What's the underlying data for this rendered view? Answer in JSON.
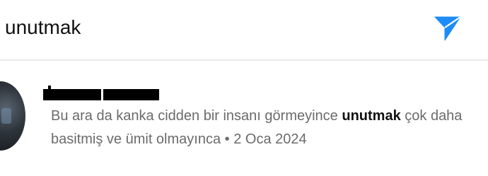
{
  "search": {
    "query": "unutmak",
    "send_icon": "paper-plane-icon",
    "send_color": "#1d8cf8"
  },
  "result": {
    "text_before": "Bu ara da kanka cidden bir insanı görmeyince ",
    "keyword": "unutmak",
    "text_after": " çok daha basitmiş ve ümit olmayınca",
    "separator": " • ",
    "date": "2 Oca 2024"
  }
}
